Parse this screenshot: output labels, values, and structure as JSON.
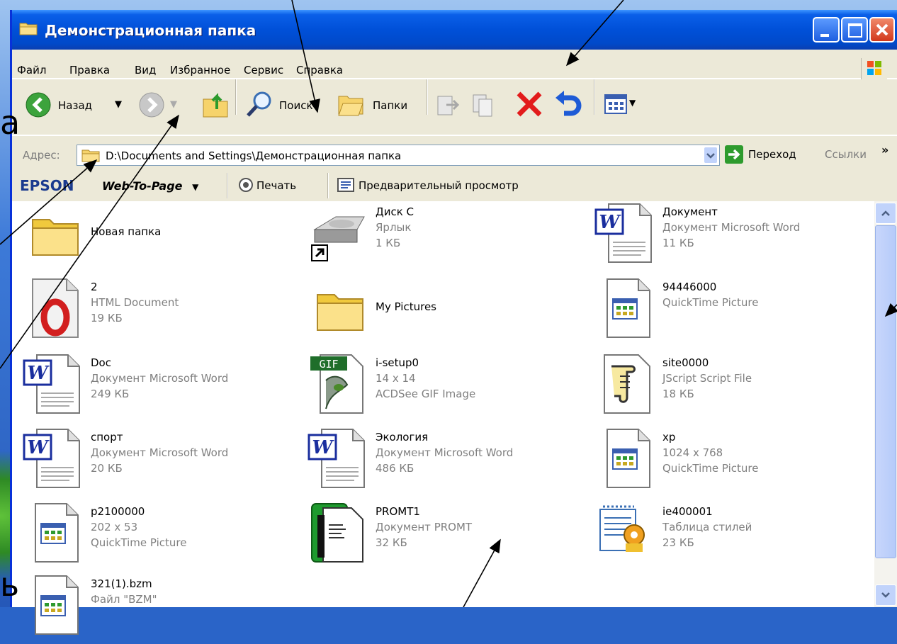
{
  "slide": {
    "left_fragment": "а",
    "bottom_fragment": "ь"
  },
  "window": {
    "title": "Демонстрационная папка"
  },
  "menu": [
    "Файл",
    "Правка",
    "Вид",
    "Избранное",
    "Сервис",
    "Справка"
  ],
  "toolbar": {
    "back": "Назад",
    "search": "Поиск",
    "folders": "Папки"
  },
  "address": {
    "label": "Адрес:",
    "value": "D:\\Documents and Settings\\Демонстрационная папка",
    "go": "Переход",
    "links": "Ссылки",
    "more": "»"
  },
  "epson": {
    "brand": "EPSON",
    "web_to_page": "Web-To-Page",
    "print": "Печать",
    "preview": "Предварительный просмотр"
  },
  "files": [
    {
      "name": "Новая папка",
      "icon": "folder-icon"
    },
    {
      "name": "Диск C",
      "type": "Ярлык",
      "size": "1 КБ",
      "icon": "drive-shortcut-icon"
    },
    {
      "name": "Документ",
      "type": "Документ Microsoft Word",
      "size": "11 КБ",
      "icon": "word-document-icon"
    },
    {
      "name": "2",
      "type": "HTML Document",
      "size": "19 КБ",
      "icon": "opera-html-icon"
    },
    {
      "name": "My Pictures",
      "icon": "folder-icon"
    },
    {
      "name": "94446000",
      "type": "QuickTime Picture",
      "icon": "quicktime-picture-icon"
    },
    {
      "name": "Doc",
      "type": "Документ Microsoft Word",
      "size": "249 КБ",
      "icon": "word-document-icon"
    },
    {
      "name": "i-setup0",
      "type": "14 x 14",
      "size": "ACDSee GIF Image",
      "icon": "gif-image-icon"
    },
    {
      "name": "site0000",
      "type": "JScript Script File",
      "size": "18 КБ",
      "icon": "script-scroll-icon"
    },
    {
      "name": "спорт",
      "type": "Документ Microsoft Word",
      "size": "20 КБ",
      "icon": "word-document-icon"
    },
    {
      "name": "Экология",
      "type": "Документ Microsoft Word",
      "size": "486 КБ",
      "icon": "word-document-icon"
    },
    {
      "name": "xp",
      "type": "1024 x 768",
      "size": "QuickTime Picture",
      "icon": "quicktime-picture-icon"
    },
    {
      "name": "p2100000",
      "type": "202 x 53",
      "size": "QuickTime Picture",
      "icon": "quicktime-picture-icon"
    },
    {
      "name": "PROMT1",
      "type": "Документ PROMT",
      "size": "32 КБ",
      "icon": "promt-document-icon"
    },
    {
      "name": "ie400001",
      "type": "Таблица стилей",
      "size": "23 КБ",
      "icon": "stylesheet-icon"
    },
    {
      "name": "321(1).bzm",
      "type": "Файл \"BZM\"",
      "icon": "quicktime-picture-icon"
    }
  ]
}
